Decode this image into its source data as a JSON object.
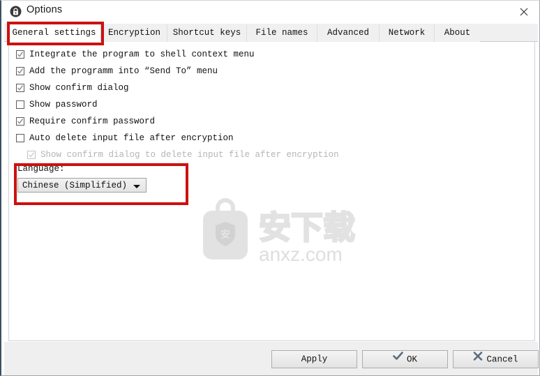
{
  "window": {
    "title": "Options",
    "title_icon": "lock-icon",
    "close_icon": "close-icon"
  },
  "tabs": [
    {
      "label": "General settings",
      "active": true
    },
    {
      "label": "Encryption",
      "active": false
    },
    {
      "label": "Shortcut keys",
      "active": false
    },
    {
      "label": "File names",
      "active": false
    },
    {
      "label": "Advanced",
      "active": false
    },
    {
      "label": "Network",
      "active": false
    },
    {
      "label": "About",
      "active": false
    }
  ],
  "general_settings": {
    "checkboxes": [
      {
        "label": "Integrate the program to shell context menu",
        "checked": true,
        "enabled": true,
        "indented": false
      },
      {
        "label": "Add the programm into “Send To” menu",
        "checked": true,
        "enabled": true,
        "indented": false
      },
      {
        "label": "Show confirm dialog",
        "checked": true,
        "enabled": true,
        "indented": false
      },
      {
        "label": "Show password",
        "checked": false,
        "enabled": true,
        "indented": false
      },
      {
        "label": "Require confirm password",
        "checked": true,
        "enabled": true,
        "indented": false
      },
      {
        "label": "Auto delete input file after encryption",
        "checked": false,
        "enabled": true,
        "indented": false
      },
      {
        "label": "Show confirm dialog to delete input file after encryption",
        "checked": true,
        "enabled": false,
        "indented": true
      }
    ],
    "language": {
      "label": "Language:",
      "selected": "Chinese (Simplified)",
      "dropdown_icon": "chevron-down-icon"
    }
  },
  "footer": {
    "apply_label": "Apply",
    "ok_label": "OK",
    "ok_icon": "check-icon",
    "cancel_label": "Cancel",
    "cancel_icon": "cross-icon"
  },
  "watermark": {
    "text_cn": "安下载",
    "shield_char": "安",
    "domain": "anxz.com"
  },
  "annotations": {
    "highlight_color": "#cc1111",
    "boxes": [
      "general-settings-tab",
      "language-group"
    ]
  }
}
